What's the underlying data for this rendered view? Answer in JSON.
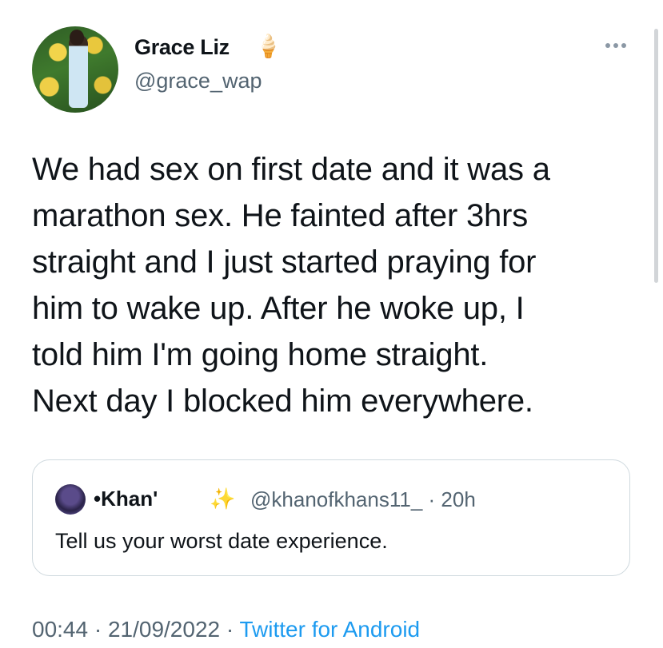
{
  "author": {
    "display_name": "Grace Liz",
    "name_emoji": "🍦",
    "handle": "@grace_wap",
    "avatar_icon": "profile-photo"
  },
  "more_icon": "more-horizontal-icon",
  "tweet_text": "We had sex on first date and it was a\nmarathon sex. He fainted after 3hrs\nstraight and I just started praying for\nhim to wake up. After he woke up, I\ntold him I'm going home straight.\nNext day I blocked him everywhere.",
  "quoted_tweet": {
    "display_name": "•Khan'",
    "name_emoji": "✨",
    "meta": "@khanofkhans11_ · 20h",
    "text": "Tell us your worst date experience."
  },
  "footer": {
    "time_date": "00:44 · 21/09/2022 · ",
    "source": "Twitter for Android"
  },
  "colors": {
    "text": "#0f1419",
    "secondary": "#536471",
    "link": "#1d9bf0",
    "border": "#cfd9de"
  }
}
